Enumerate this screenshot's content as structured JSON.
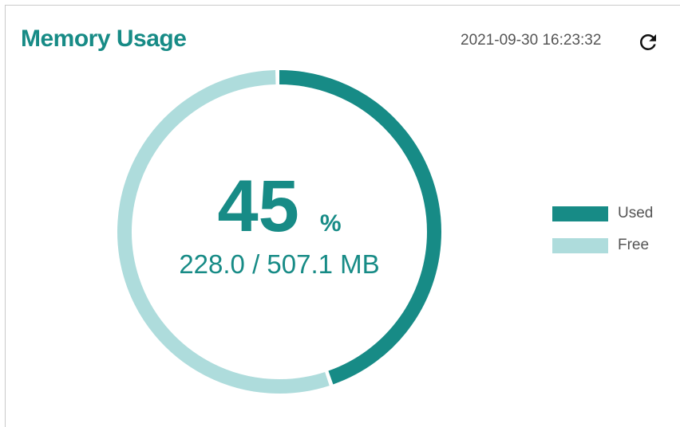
{
  "widget": {
    "title": "Memory Usage",
    "timestamp": "2021-09-30 16:23:32",
    "refresh_icon": "refresh-icon"
  },
  "usage": {
    "percent_value": "45",
    "percent_unit": "%",
    "detail": "228.0 / 507.1 MB",
    "used_fraction": 0.45
  },
  "legend": {
    "used_label": "Used",
    "free_label": "Free"
  },
  "colors": {
    "accent": "#178b86",
    "used": "#178b86",
    "free": "#aedcdc"
  }
}
